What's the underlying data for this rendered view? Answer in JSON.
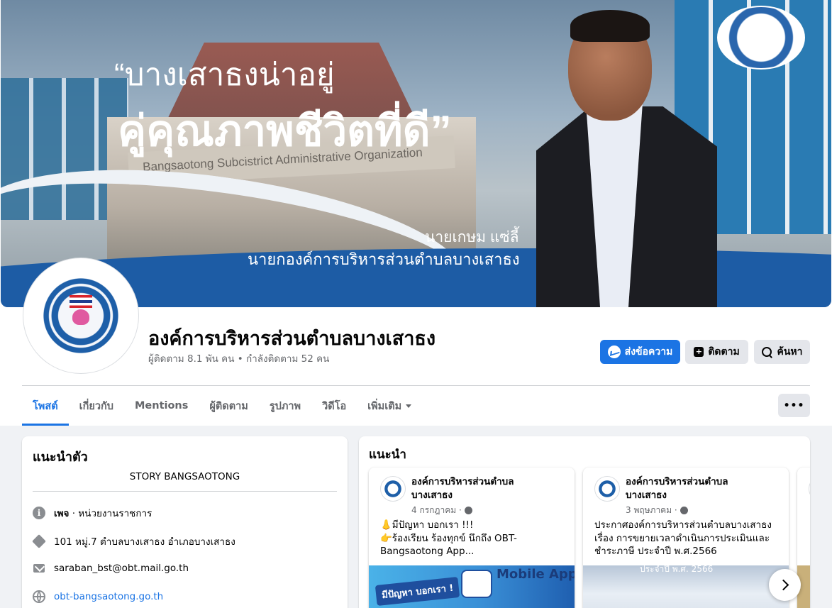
{
  "cover": {
    "quote_line1": "“บางเสาธงน่าอยู่",
    "quote_line2": "คู่คุณภาพชีวิตที่ดี”",
    "building_sign": "Bangsaotong Subcistrict Administrative Organization",
    "person_name": "นายเกษม  แซ่ลี้",
    "person_title": "นายกองค์การบริหารส่วนตำบลบางเสาธง"
  },
  "profile": {
    "name": "องค์การบริหารส่วนตำบลบางเสาธง",
    "stats": "ผู้ติดตาม 8.1 พัน คน • กำลังติดตาม 52 คน"
  },
  "actions": {
    "message": "ส่งข้อความ",
    "follow": "ติดตาม",
    "search": "ค้นหา"
  },
  "tabs": [
    {
      "label": "โพสต์"
    },
    {
      "label": "เกี่ยวกับ"
    },
    {
      "label": "Mentions"
    },
    {
      "label": "ผู้ติดตาม"
    },
    {
      "label": "รูปภาพ"
    },
    {
      "label": "วิดีโอ"
    },
    {
      "label": "เพิ่มเติม"
    }
  ],
  "more_button": "•••",
  "intro": {
    "title": "แนะนำตัว",
    "story": "STORY BANGSAOTONG",
    "category_bold": "เพจ",
    "category_rest": " · หน่วยงานราชการ",
    "address": "101 หมู่.7 ตำบลบางเสาธง อำเภอบางเสาธง",
    "email": "saraban_bst@obt.mail.go.th",
    "website": "obt-bangsaotong.go.th"
  },
  "featured": {
    "title": "แนะนำ",
    "posts": [
      {
        "author": "องค์การบริหารส่วนตำบลบางเสาธง",
        "date": "4 กรกฎาคม ·",
        "text": "👃มีปัญหา บอกเรา !!!\n👉ร้องเรียน ร้องทุกข์ นึกถึง OBT-Bangsaotong App...",
        "image_tag": "มีปัญหา บอกเรา !",
        "image_title": "Mobile App"
      },
      {
        "author": "องค์การบริหารส่วนตำบลบางเสาธง",
        "date": "3 พฤษภาคม ·",
        "text": "ประกาศองค์การบริหารส่วนตำบลบางเสาธง เรื่อง การขยายเวลาดำเนินการประเมินและชำระภาษี ประจำปี พ.ศ.2566",
        "image_caption": "ประจำปี พ.ศ. 2566"
      }
    ]
  },
  "colors": {
    "accent": "#1b74e4",
    "cover_blue": "#1d5ca5",
    "page_bg": "#f0f2f5"
  }
}
